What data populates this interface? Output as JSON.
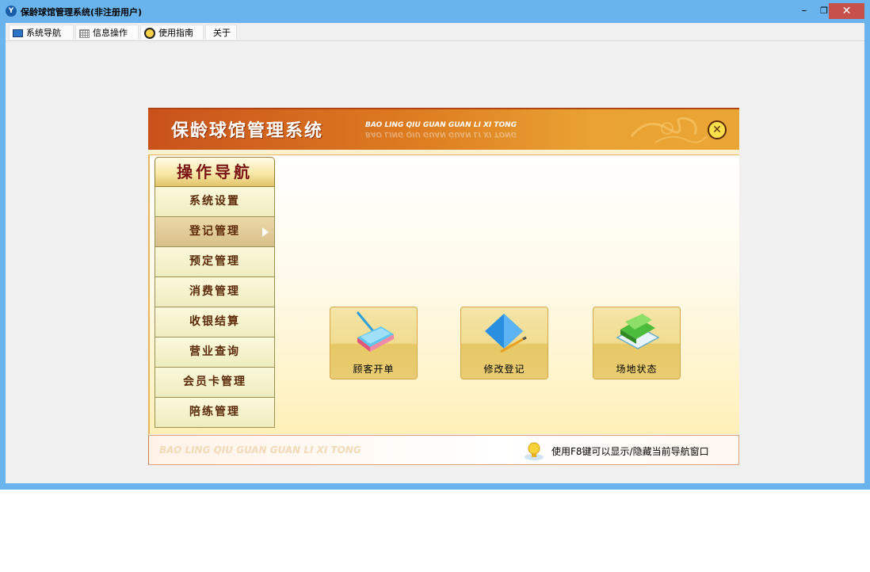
{
  "window": {
    "title": "保龄球馆管理系统(非注册用户)",
    "controls": {
      "minimize": "–",
      "restore": "❐",
      "close": "✕"
    }
  },
  "menubar": {
    "items": [
      {
        "label": "系统导航",
        "icon": "monitor-icon"
      },
      {
        "label": "信息操作",
        "icon": "grid-icon"
      },
      {
        "label": "使用指南",
        "icon": "help-icon"
      },
      {
        "label": "关于"
      }
    ]
  },
  "panel": {
    "title": "保龄球馆管理系统",
    "subtitle": "BAO LING QIU GUAN GUAN LI XI TONG",
    "close_icon": "✕"
  },
  "nav": {
    "heading": "操作导航",
    "items": [
      {
        "label": "系统设置"
      },
      {
        "label": "登记管理",
        "active": true
      },
      {
        "label": "预定管理"
      },
      {
        "label": "消费管理"
      },
      {
        "label": "收银结算"
      },
      {
        "label": "营业查询"
      },
      {
        "label": "会员卡管理"
      },
      {
        "label": "陪练管理"
      }
    ]
  },
  "tiles": [
    {
      "label": "顾客开单",
      "icon": "pen-book-icon"
    },
    {
      "label": "修改登记",
      "icon": "edit-notebook-icon"
    },
    {
      "label": "场地状态",
      "icon": "books-icon"
    }
  ],
  "footer": {
    "brand": "BAO LING QIU GUAN GUAN LI XI TONG",
    "hint": "使用F8键可以显示/隐藏当前导航窗口"
  },
  "colors": {
    "titlebar": "#6ab4ee",
    "banner_start": "#c9521c",
    "banner_end": "#eaa634",
    "close_button": "#c7504a"
  }
}
